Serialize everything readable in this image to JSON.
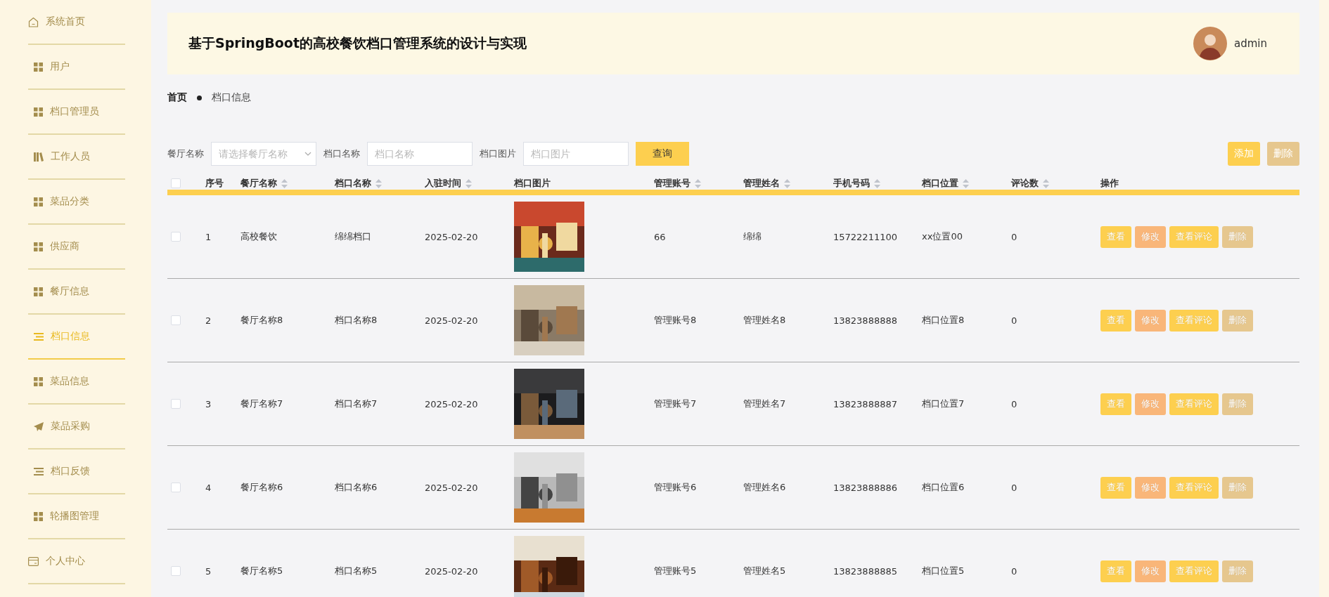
{
  "sidebar": {
    "items": [
      {
        "label": "系统首页",
        "kind": "page",
        "selected": false
      },
      {
        "label": "用户",
        "kind": "module",
        "selected": false
      },
      {
        "label": "档口管理员",
        "kind": "module",
        "selected": false
      },
      {
        "label": "工作人员",
        "kind": "module",
        "selected": false
      },
      {
        "label": "菜品分类",
        "kind": "module",
        "selected": false
      },
      {
        "label": "供应商",
        "kind": "module",
        "selected": false
      },
      {
        "label": "餐厅信息",
        "kind": "module",
        "selected": false
      },
      {
        "label": "档口信息",
        "kind": "module",
        "selected": true
      },
      {
        "label": "菜品信息",
        "kind": "module",
        "selected": false
      },
      {
        "label": "菜品采购",
        "kind": "module",
        "selected": false
      },
      {
        "label": "档口反馈",
        "kind": "module",
        "selected": false
      },
      {
        "label": "轮播图管理",
        "kind": "module",
        "selected": false
      },
      {
        "label": "个人中心",
        "kind": "page",
        "selected": false
      }
    ]
  },
  "header": {
    "title": "基于SpringBoot的高校餐饮档口管理系统的设计与实现",
    "user": "admin"
  },
  "breadcrumb": [
    "首页",
    "档口信息"
  ],
  "filters": [
    {
      "label": "餐厅名称",
      "kind": "select",
      "placeholder": "请选择餐厅名称"
    },
    {
      "label": "档口名称",
      "kind": "input",
      "placeholder": "档口名称"
    },
    {
      "label": "档口图片",
      "kind": "input",
      "placeholder": "档口图片"
    }
  ],
  "search_button": "查询",
  "toolbar": [
    {
      "label": "添加",
      "kind": "add"
    },
    {
      "label": "删除",
      "kind": "delete"
    }
  ],
  "table": {
    "header_checked": false,
    "columns": [
      {
        "label": "序号",
        "sortable": false
      },
      {
        "label": "餐厅名称",
        "sortable": true
      },
      {
        "label": "档口名称",
        "sortable": true
      },
      {
        "label": "入驻时间",
        "sortable": true
      },
      {
        "label": "档口图片",
        "sortable": false
      },
      {
        "label": "管理账号",
        "sortable": true
      },
      {
        "label": "管理姓名",
        "sortable": true
      },
      {
        "label": "手机号码",
        "sortable": true
      },
      {
        "label": "档口位置",
        "sortable": true
      },
      {
        "label": "评论数",
        "sortable": true
      },
      {
        "label": "操作",
        "sortable": false
      }
    ],
    "rows": [
      {
        "checked": false,
        "cells": [
          "1",
          "高校餐饮",
          "绵绵档口",
          "2025-02-20",
          {
            "kind": "picture"
          },
          "66",
          "绵绵",
          "15722211100",
          "xx位置00",
          "0"
        ],
        "actions": [
          {
            "label": "查看",
            "kind": "view"
          },
          {
            "label": "修改",
            "kind": "edit"
          },
          {
            "label": "查看评论",
            "kind": "view"
          },
          {
            "label": "删除",
            "kind": "delete"
          }
        ]
      },
      {
        "checked": false,
        "cells": [
          "2",
          "餐厅名称8",
          "档口名称8",
          "2025-02-20",
          {
            "kind": "picture"
          },
          "管理账号8",
          "管理姓名8",
          "13823888888",
          "档口位置8",
          "0"
        ],
        "actions": [
          {
            "label": "查看",
            "kind": "view"
          },
          {
            "label": "修改",
            "kind": "edit"
          },
          {
            "label": "查看评论",
            "kind": "view"
          },
          {
            "label": "删除",
            "kind": "delete"
          }
        ]
      },
      {
        "checked": false,
        "cells": [
          "3",
          "餐厅名称7",
          "档口名称7",
          "2025-02-20",
          {
            "kind": "picture"
          },
          "管理账号7",
          "管理姓名7",
          "13823888887",
          "档口位置7",
          "0"
        ],
        "actions": [
          {
            "label": "查看",
            "kind": "view"
          },
          {
            "label": "修改",
            "kind": "edit"
          },
          {
            "label": "查看评论",
            "kind": "view"
          },
          {
            "label": "删除",
            "kind": "delete"
          }
        ]
      },
      {
        "checked": false,
        "cells": [
          "4",
          "餐厅名称6",
          "档口名称6",
          "2025-02-20",
          {
            "kind": "picture"
          },
          "管理账号6",
          "管理姓名6",
          "13823888886",
          "档口位置6",
          "0"
        ],
        "actions": [
          {
            "label": "查看",
            "kind": "view"
          },
          {
            "label": "修改",
            "kind": "edit"
          },
          {
            "label": "查看评论",
            "kind": "view"
          },
          {
            "label": "删除",
            "kind": "delete"
          }
        ]
      },
      {
        "checked": false,
        "cells": [
          "5",
          "餐厅名称5",
          "档口名称5",
          "2025-02-20",
          {
            "kind": "picture"
          },
          "管理账号5",
          "管理姓名5",
          "13823888885",
          "档口位置5",
          "0"
        ],
        "actions": [
          {
            "label": "查看",
            "kind": "view"
          },
          {
            "label": "修改",
            "kind": "edit"
          },
          {
            "label": "查看评论",
            "kind": "view"
          },
          {
            "label": "删除",
            "kind": "delete"
          }
        ]
      }
    ]
  }
}
